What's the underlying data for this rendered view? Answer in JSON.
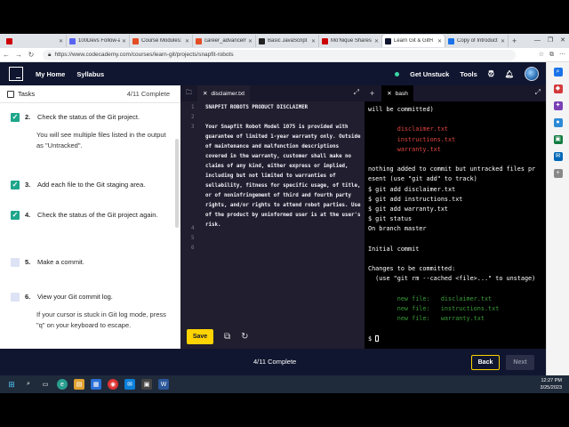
{
  "browser": {
    "tabs": [
      {
        "title": "",
        "color": "#cc0000",
        "icon": "youtube-icon"
      },
      {
        "title": "100Devs Follow-a",
        "color": "#5865f2",
        "icon": "doc-icon"
      },
      {
        "title": "Course Modules:",
        "color": "#e44d26",
        "icon": "course-icon"
      },
      {
        "title": "career_advancem",
        "color": "#e44d26",
        "icon": "course-icon"
      },
      {
        "title": "Basic JavaScript",
        "color": "#222222",
        "icon": "fcc-icon"
      },
      {
        "title": "Mo'Nique Shares",
        "color": "#cc0000",
        "icon": "youtube-icon"
      },
      {
        "title": "Learn Git & GitH",
        "color": "#10162f",
        "icon": "codecademy-icon",
        "active": true
      },
      {
        "title": "Copy of Introduct",
        "color": "#1a73e8",
        "icon": "doc-icon"
      }
    ],
    "new_tab": "+",
    "url": "https://www.codecademy.com/courses/learn-git/projects/snapfit-robots"
  },
  "header": {
    "links": [
      "My Home",
      "Syllabus"
    ],
    "get_unstuck": "Get Unstuck",
    "tools": "Tools"
  },
  "tasks_panel": {
    "title": "Tasks",
    "count": "4/11 Complete",
    "tasks": [
      {
        "num": "2.",
        "text": "Check the status of the Git project.",
        "done": true,
        "note": "You will see multiple files listed in the output as \"Untracked\"."
      },
      {
        "num": "3.",
        "text": "Add each file to the Git staging area.",
        "done": true,
        "note": ""
      },
      {
        "num": "4.",
        "text": "Check the status of the Git project again.",
        "done": true,
        "note": ""
      },
      {
        "num": "5.",
        "text": "Make a commit.",
        "done": false,
        "note": ""
      },
      {
        "num": "6.",
        "text": "View your Git commit log.",
        "done": false,
        "note": "If your cursor is stuck in Git log mode, press \"q\" on your keyboard to escape."
      }
    ]
  },
  "editor": {
    "filename": "disclaimer.txt",
    "lines": [
      {
        "n": "1",
        "t": "SNAPFIT ROBOTS PRODUCT DISCLAIMER"
      },
      {
        "n": "2",
        "t": ""
      },
      {
        "n": "3",
        "t": "Your Snapfit Robot Model 1075 is provided with guarantee of limited 1-year warranty only. Outside of maintenance and malfunction descriptions covered in the warranty, customer shall make no claims of any kind, either express or implied, including but not limited to warranties of sellability, fitness for specific usage, of title, or of noninfringement of third and fourth party rights, and/or rights to attend robot parties. Use of the product by uninformed user is at the user's risk."
      },
      {
        "n": "4",
        "t": ""
      },
      {
        "n": "5",
        "t": ""
      },
      {
        "n": "6",
        "t": ""
      }
    ],
    "save_label": "Save"
  },
  "terminal": {
    "tab_label": "bash",
    "lines": [
      {
        "t": "will be committed)",
        "c": ""
      },
      {
        "t": "",
        "c": ""
      },
      {
        "t": "        disclaimer.txt",
        "c": "red"
      },
      {
        "t": "        instructions.txt",
        "c": "red"
      },
      {
        "t": "        warranty.txt",
        "c": "red"
      },
      {
        "t": "",
        "c": ""
      },
      {
        "t": "nothing added to commit but untracked files pr",
        "c": ""
      },
      {
        "t": "esent (use \"git add\" to track)",
        "c": ""
      },
      {
        "t": "$ git add disclaimer.txt",
        "c": ""
      },
      {
        "t": "$ git add instructions.txt",
        "c": ""
      },
      {
        "t": "$ git add warranty.txt",
        "c": ""
      },
      {
        "t": "$ git status",
        "c": ""
      },
      {
        "t": "On branch master",
        "c": ""
      },
      {
        "t": "",
        "c": ""
      },
      {
        "t": "Initial commit",
        "c": ""
      },
      {
        "t": "",
        "c": ""
      },
      {
        "t": "Changes to be committed:",
        "c": ""
      },
      {
        "t": "  (use \"git rm --cached <file>...\" to unstage)",
        "c": ""
      },
      {
        "t": "",
        "c": ""
      },
      {
        "t": "        new file:   disclaimer.txt",
        "c": "green"
      },
      {
        "t": "        new file:   instructions.txt",
        "c": "green"
      },
      {
        "t": "        new file:   warranty.txt",
        "c": "green"
      },
      {
        "t": "",
        "c": ""
      },
      {
        "t": "$ ",
        "c": "",
        "cursor": true
      }
    ]
  },
  "footer": {
    "progress": "4/11 Complete",
    "back": "Back",
    "next": "Next"
  },
  "taskbar": {
    "time": "12:27 PM",
    "date": "3/25/2023"
  },
  "colors": {
    "navy": "#10162f",
    "accent_yellow": "#ffd300",
    "done_green": "#1fa68b",
    "term_red": "#e0463f",
    "term_green": "#3a9d3a"
  }
}
